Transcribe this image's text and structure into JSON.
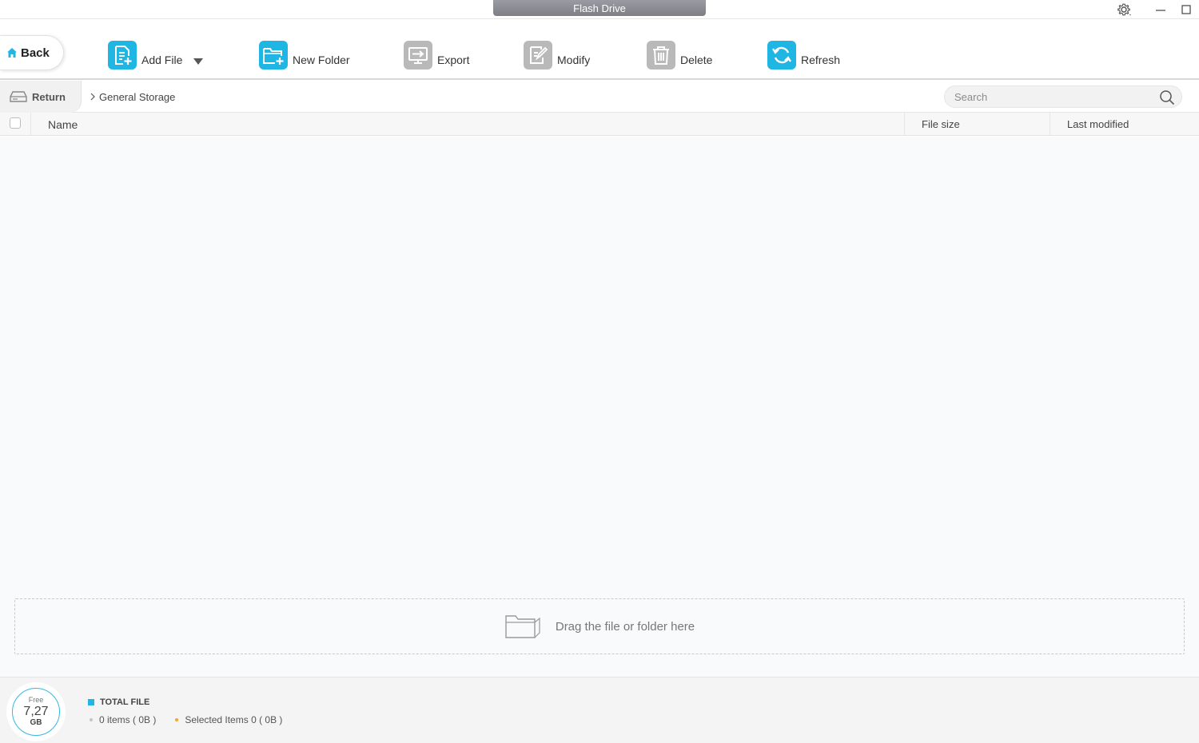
{
  "window": {
    "title": "Flash Drive",
    "controls": {
      "settings": "gear-icon",
      "minimize": "minimize-icon",
      "maximize": "maximize-icon"
    }
  },
  "toolbar": {
    "back_label": "Back",
    "add_file_label": "Add File",
    "new_folder_label": "New Folder",
    "export_label": "Export",
    "modify_label": "Modify",
    "delete_label": "Delete",
    "refresh_label": "Refresh"
  },
  "pathbar": {
    "return_label": "Return",
    "breadcrumb": [
      "General Storage"
    ],
    "search_placeholder": "Search"
  },
  "table": {
    "columns": {
      "name": "Name",
      "size": "File size",
      "modified": "Last modified"
    },
    "rows": []
  },
  "dropzone": {
    "text": "Drag the file or folder here"
  },
  "footer": {
    "free_label": "Free",
    "free_value": "7,27",
    "free_unit": "GB",
    "total_label": "TOTAL FILE",
    "items_text": "0 items ( 0B )",
    "selected_text": "Selected Items 0 ( 0B )"
  },
  "colors": {
    "accent": "#1fb6e3",
    "disabled": "#b9b9b9",
    "selected_dot": "#f5a623"
  }
}
